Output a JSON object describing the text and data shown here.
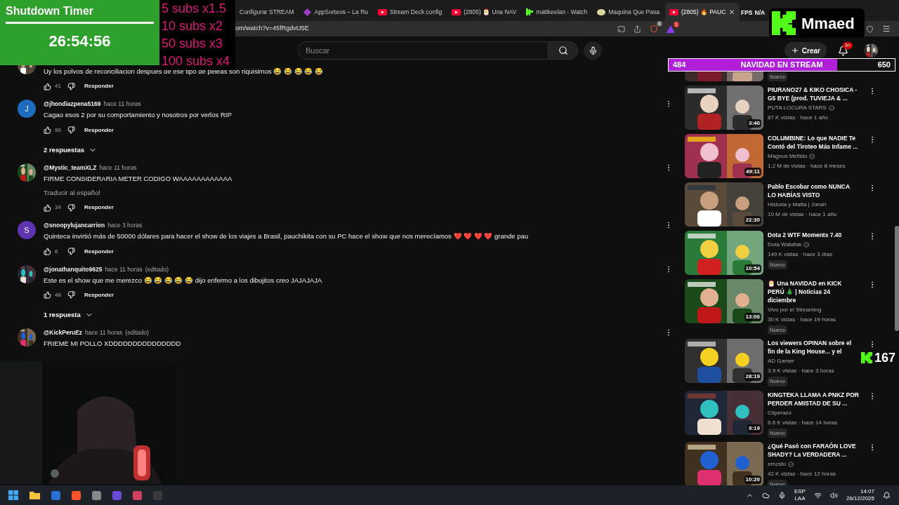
{
  "overlays": {
    "timer": {
      "title": "Shutdown Timer",
      "time": "26:54:56"
    },
    "subs_multipliers": [
      "5 subs x1.5",
      "10 subs x2",
      "50 subs x3",
      "100 subs x4"
    ],
    "kick_badge": {
      "name": "Mmaed"
    },
    "goal": {
      "current": "484",
      "label": "NAVIDAD EN STREAM",
      "target": "650",
      "level": 0.745
    },
    "viewers": {
      "count": "167"
    },
    "fps": {
      "label": "FPS",
      "value": "N/A"
    }
  },
  "browser": {
    "tabs": [
      {
        "title": "Configurar STREAM",
        "kind": "plain",
        "selected": false
      },
      {
        "title": "AppSorteos – La Ru",
        "kind": "apps",
        "selected": false
      },
      {
        "title": "Stream Deck config",
        "kind": "video",
        "selected": false
      },
      {
        "title": "(2805) 🎅 Una NAV",
        "kind": "video",
        "selected": false
      },
      {
        "title": "mattkeelan - Watch",
        "kind": "kick",
        "selected": false
      },
      {
        "title": "Maquina Que Pasa",
        "kind": "disc",
        "selected": false
      },
      {
        "title": "(2805) 🔥 PAUC",
        "kind": "video",
        "selected": true
      }
    ],
    "url": "om/watch?v=45fRgdvtJ5E",
    "shield_count": "6",
    "alert_count": "1"
  },
  "header": {
    "search_placeholder": "Buscar",
    "create": "Crear",
    "notifications": "9+"
  },
  "comments": [
    {
      "text": "Uy los polvos de reconciliacion despues de ese tipo de peleas son riquisimos 😂 😂 😂 😂 😂",
      "likes": "41",
      "reply": "Responder"
    },
    {
      "kind": "letter",
      "letter": "J",
      "color": "#1e6bbf",
      "author": "@jhondiazpena5169",
      "time": "hace 11 horas",
      "text": "Cagao esos 2 por su comportamiento y nosotros por verlos RIP",
      "likes": "90",
      "reply": "Responder",
      "replies": "2 respuestas"
    },
    {
      "author": "@Mystic_teamXLZ",
      "time": "hace 11 horas",
      "text": "FIRME CONSIDERARIA METER CODIGO WAAAAAAAAAAAA",
      "translate": "Traducir al español",
      "likes": "34",
      "reply": "Responder"
    },
    {
      "kind": "letter",
      "letter": "S",
      "color": "#5e35b1",
      "author": "@snoopylujancarrion",
      "time": "hace 3 horas",
      "text": "Quinteca invirtió más de 50000 dólares para hacer el show de los viajes a Brasil, pauchikita con su PC hace el show que nos merecíamos ❤️ ❤️ ❤️ ❤️ grande pau",
      "likes": "6",
      "reply": "Responder"
    },
    {
      "author": "@jonathanquito9625",
      "time": "hace 11 horas",
      "edited": "(editado)",
      "text": "Este es el show que me merezco 😂 😂 😂 😂 😂 dijo enfermo a los dibujitos creo JAJAJAJA",
      "likes": "48",
      "reply": "Responder",
      "replies": "1 respuesta"
    },
    {
      "author": "@KickPeruEz",
      "time": "hace 11 horas",
      "edited": "(editado)",
      "text": "FRIEME MI POLLO XDDDDDDDDDDDDDDD"
    }
  ],
  "videos": [
    {
      "new": "Nuevo"
    },
    {
      "title": "PIURANO27 & KIKO CHOSICA - G5 BYE (prod. TUVIEJA & ...",
      "channel": "PUTA LOCURA STARS",
      "verified": true,
      "stats": "87 K vistas · hace 1 año",
      "duration": "3:40"
    },
    {
      "title": "COLUMBINE: Lo que NADIE Te Contó del Tiroteo Más Infame ...",
      "channel": "Magnus Mefisto",
      "verified": true,
      "stats": "1.2 M de vistas · hace 8 meses",
      "duration": "49:11"
    },
    {
      "title": "Pablo Escobar como NUNCA LO HABÍAS VISTO",
      "channel": "Historia y Mafia | Jonah",
      "verified": false,
      "stats": "10 M de vistas · hace 1 año",
      "duration": "22:30"
    },
    {
      "title": "Dota 2 WTF Moments 7.40",
      "channel": "Dota Watafak",
      "verified": true,
      "stats": "149 K vistas · hace 3 días",
      "new": "Nuevo",
      "duration": "10:54"
    },
    {
      "title": "🎅 Una NAVIDAD en KICK PERÚ 🎄 | Noticias 24 diciembre",
      "channel": "Vivo por el Streaming",
      "verified": false,
      "stats": "30 K vistas · hace 19 horas",
      "new": "Nuevo",
      "duration": "13:06"
    },
    {
      "title": "Los viewers OPINAN sobre el fin de la King House... y el",
      "channel": "AD Gamer",
      "verified": false,
      "stats": "3.9 K vistas · hace 3 horas",
      "new": "Nuevo",
      "duration": "28:19"
    },
    {
      "title": "KINGTEKA LLAMA A PNKZ POR PERDER AMISTAD DE SU ...",
      "channel": "Cliperazo",
      "verified": false,
      "stats": "6.6 K vistas · hace 14 horas",
      "new": "Nuevo",
      "duration": "9:19"
    },
    {
      "title": "¿Qué Pasó con FARAÓN LOVE SHADY? La VERDADERA ...",
      "channel": "ernzsto",
      "verified": true,
      "stats": "42 K vistas · hace 12 horas",
      "new": "Nuevo",
      "duration": "10:20"
    }
  ],
  "taskbar": {
    "language": "ESP",
    "layout": "LAA",
    "time": "14:07",
    "date": "26/12/2025"
  }
}
